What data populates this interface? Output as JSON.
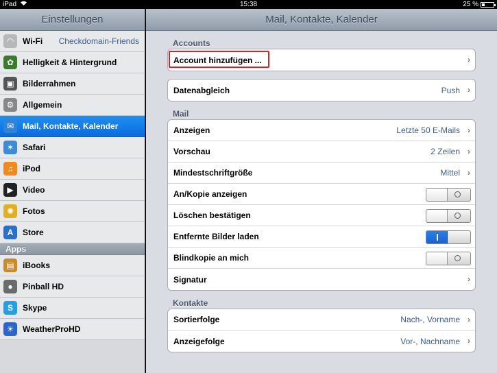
{
  "status": {
    "device": "iPad",
    "time": "15:38",
    "battery": "25 %",
    "battery_level": 0.25
  },
  "sidebar": {
    "title": "Einstellungen",
    "items": [
      {
        "label": "Wi-Fi",
        "value": "Checkdomain-Friends",
        "icon": "wifi-icon"
      },
      {
        "label": "Helligkeit & Hintergrund",
        "icon": "flower-icon"
      },
      {
        "label": "Bilderrahmen",
        "icon": "picture-frame-icon"
      },
      {
        "label": "Allgemein",
        "icon": "gear-icon"
      },
      {
        "label": "Mail, Kontakte, Kalender",
        "icon": "mail-icon",
        "selected": true
      },
      {
        "label": "Safari",
        "icon": "compass-icon"
      },
      {
        "label": "iPod",
        "icon": "music-icon"
      },
      {
        "label": "Video",
        "icon": "clapper-icon"
      },
      {
        "label": "Fotos",
        "icon": "sunflower-icon"
      },
      {
        "label": "Store",
        "icon": "store-icon"
      }
    ],
    "apps_section": "Apps",
    "apps": [
      {
        "label": "iBooks",
        "icon": "book-icon"
      },
      {
        "label": "Pinball HD",
        "icon": "pinball-icon"
      },
      {
        "label": "Skype",
        "icon": "skype-icon"
      },
      {
        "label": "WeatherProHD",
        "icon": "weather-icon"
      }
    ]
  },
  "main": {
    "title": "Mail, Kontakte, Kalender",
    "accounts_label": "Accounts",
    "add_account": "Account hinzufügen ...",
    "fetch": {
      "label": "Datenabgleich",
      "value": "Push"
    },
    "mail_label": "Mail",
    "mail_rows": [
      {
        "label": "Anzeigen",
        "value": "Letzte 50 E-Mails",
        "type": "chevron"
      },
      {
        "label": "Vorschau",
        "value": "2 Zeilen",
        "type": "chevron"
      },
      {
        "label": "Mindestschriftgröße",
        "value": "Mittel",
        "type": "chevron"
      },
      {
        "label": "An/Kopie anzeigen",
        "type": "toggle",
        "on": false
      },
      {
        "label": "Löschen bestätigen",
        "type": "toggle",
        "on": false
      },
      {
        "label": "Entfernte Bilder laden",
        "type": "toggle",
        "on": true
      },
      {
        "label": "Blindkopie an mich",
        "type": "toggle",
        "on": false
      },
      {
        "label": "Signatur",
        "type": "chevron"
      }
    ],
    "contacts_label": "Kontakte",
    "contact_rows": [
      {
        "label": "Sortierfolge",
        "value": "Nach-, Vorname"
      },
      {
        "label": "Anzeigefolge",
        "value": "Vor-, Nachname"
      }
    ]
  },
  "colors": {
    "selected": "#0a6bde",
    "highlight": "#e52020"
  }
}
